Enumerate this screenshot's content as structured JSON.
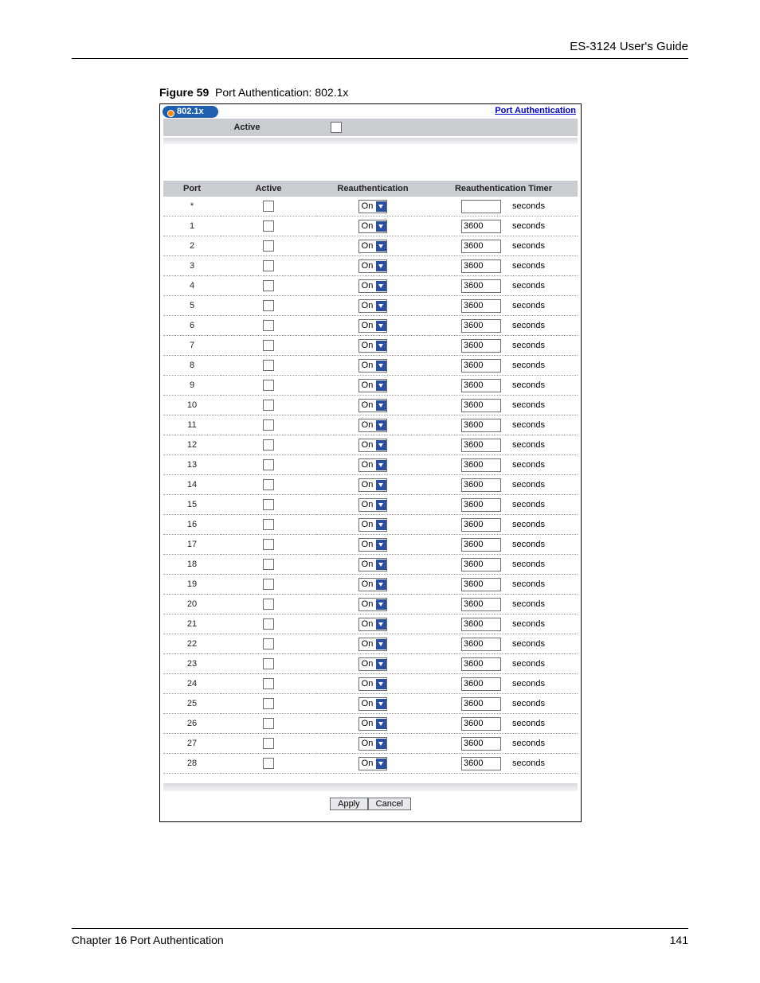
{
  "header": {
    "guide": "ES-3124 User's Guide"
  },
  "figure": {
    "label": "Figure 59",
    "title": "Port Authentication: 802.1x"
  },
  "panel": {
    "tab": "802.1x",
    "link": "Port Authentication",
    "active_label": "Active",
    "columns": {
      "port": "Port",
      "active": "Active",
      "reauth": "Reauthentication",
      "timer": "Reauthentication Timer"
    },
    "reauth_option": "On",
    "unit": "seconds",
    "rows": [
      {
        "port": "*",
        "timer": ""
      },
      {
        "port": "1",
        "timer": "3600"
      },
      {
        "port": "2",
        "timer": "3600"
      },
      {
        "port": "3",
        "timer": "3600"
      },
      {
        "port": "4",
        "timer": "3600"
      },
      {
        "port": "5",
        "timer": "3600"
      },
      {
        "port": "6",
        "timer": "3600"
      },
      {
        "port": "7",
        "timer": "3600"
      },
      {
        "port": "8",
        "timer": "3600"
      },
      {
        "port": "9",
        "timer": "3600"
      },
      {
        "port": "10",
        "timer": "3600"
      },
      {
        "port": "11",
        "timer": "3600"
      },
      {
        "port": "12",
        "timer": "3600"
      },
      {
        "port": "13",
        "timer": "3600"
      },
      {
        "port": "14",
        "timer": "3600"
      },
      {
        "port": "15",
        "timer": "3600"
      },
      {
        "port": "16",
        "timer": "3600"
      },
      {
        "port": "17",
        "timer": "3600"
      },
      {
        "port": "18",
        "timer": "3600"
      },
      {
        "port": "19",
        "timer": "3600"
      },
      {
        "port": "20",
        "timer": "3600"
      },
      {
        "port": "21",
        "timer": "3600"
      },
      {
        "port": "22",
        "timer": "3600"
      },
      {
        "port": "23",
        "timer": "3600"
      },
      {
        "port": "24",
        "timer": "3600"
      },
      {
        "port": "25",
        "timer": "3600"
      },
      {
        "port": "26",
        "timer": "3600"
      },
      {
        "port": "27",
        "timer": "3600"
      },
      {
        "port": "28",
        "timer": "3600"
      }
    ],
    "buttons": {
      "apply": "Apply",
      "cancel": "Cancel"
    }
  },
  "footer": {
    "chapter": "Chapter 16 Port Authentication",
    "page": "141"
  }
}
